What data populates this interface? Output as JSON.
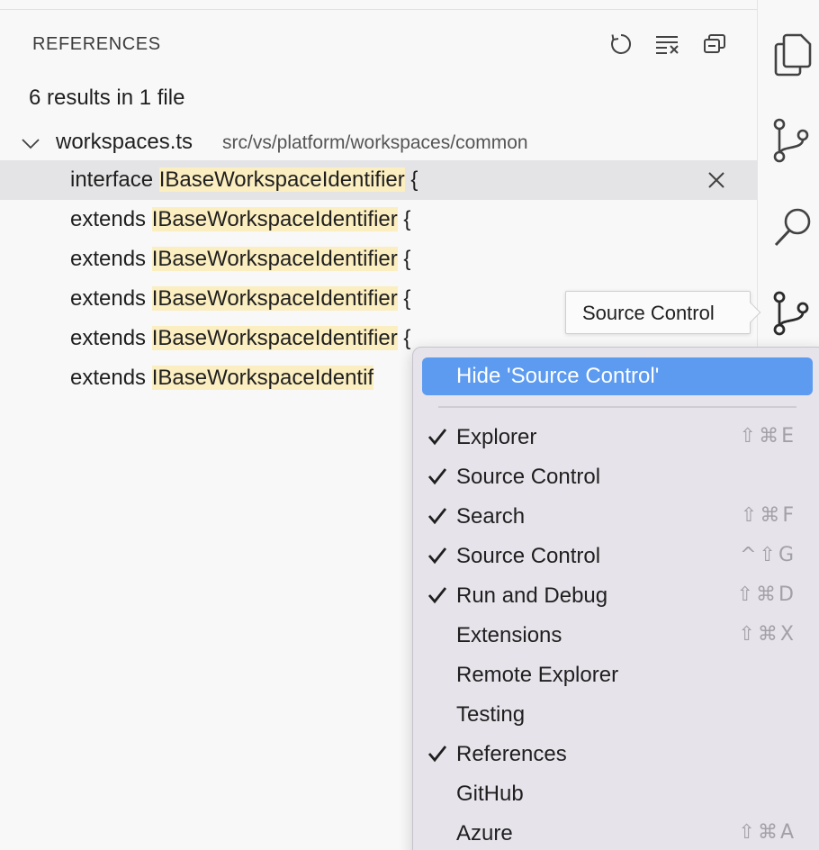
{
  "panel": {
    "title": "REFERENCES",
    "summary": "6 results in 1 file",
    "actions": [
      "refresh-icon",
      "clear-results-icon",
      "collapse-all-icon"
    ],
    "file": {
      "name": "workspaces.ts",
      "path": "src/vs/platform/workspaces/common"
    },
    "results": [
      {
        "prefix": "interface ",
        "match": "IBaseWorkspaceIdentifier",
        "suffix": " {"
      },
      {
        "prefix": "extends ",
        "match": "IBaseWorkspaceIdentifier",
        "suffix": " {"
      },
      {
        "prefix": "extends ",
        "match": "IBaseWorkspaceIdentifier",
        "suffix": " {"
      },
      {
        "prefix": "extends ",
        "match": "IBaseWorkspaceIdentifier",
        "suffix": " {"
      },
      {
        "prefix": "extends ",
        "match": "IBaseWorkspaceIdentifier",
        "suffix": " {"
      },
      {
        "prefix": "extends ",
        "match": "IBaseWorkspaceIdentif",
        "suffix": ""
      }
    ]
  },
  "activity_bar": [
    "explorer-icon",
    "source-control-icon",
    "search-icon",
    "source-control-icon"
  ],
  "tooltip": {
    "text": "Source Control"
  },
  "context_menu": {
    "hide_label": "Hide 'Source Control'",
    "items": [
      {
        "label": "Explorer",
        "checked": true,
        "shortcut": "⇧⌘E"
      },
      {
        "label": "Source Control",
        "checked": true,
        "shortcut": ""
      },
      {
        "label": "Search",
        "checked": true,
        "shortcut": "⇧⌘F"
      },
      {
        "label": "Source Control",
        "checked": true,
        "shortcut": "^⇧G"
      },
      {
        "label": "Run and Debug",
        "checked": true,
        "shortcut": "⇧⌘D"
      },
      {
        "label": "Extensions",
        "checked": false,
        "shortcut": "⇧⌘X"
      },
      {
        "label": "Remote Explorer",
        "checked": false,
        "shortcut": ""
      },
      {
        "label": "Testing",
        "checked": false,
        "shortcut": ""
      },
      {
        "label": "References",
        "checked": true,
        "shortcut": ""
      },
      {
        "label": "GitHub",
        "checked": false,
        "shortcut": ""
      },
      {
        "label": "Azure",
        "checked": false,
        "shortcut": "⇧⌘A"
      }
    ]
  },
  "colors": {
    "highlight": "#fbeec1",
    "selected_row": "#e4e4e6",
    "menu_accent": "#5c9bf0",
    "menu_bg": "#e6e3ea"
  }
}
